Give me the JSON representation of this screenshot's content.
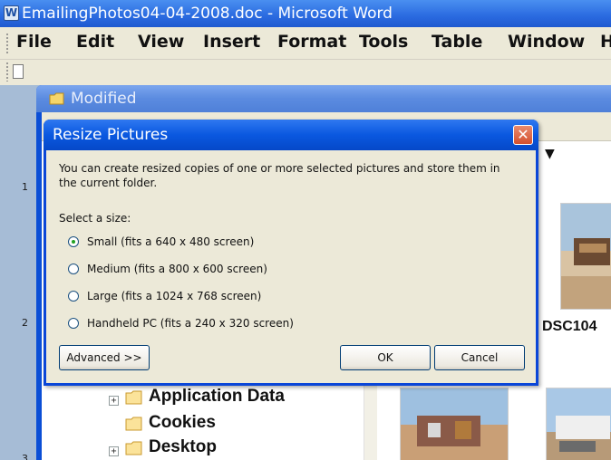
{
  "word": {
    "title": "EmailingPhotos04-04-2008.doc - Microsoft Word",
    "menu": [
      "File",
      "Edit",
      "View",
      "Insert",
      "Format",
      "Tools",
      "Table",
      "Window",
      "H"
    ],
    "ruler_numbers": [
      "1",
      "2",
      "3"
    ]
  },
  "explorer": {
    "title": "Modified",
    "tree": [
      {
        "label": "Application Data",
        "expandable": true
      },
      {
        "label": "Cookies",
        "expandable": false
      },
      {
        "label": "Desktop",
        "expandable": true
      }
    ],
    "thumbnail_label": "DSC104"
  },
  "dialog": {
    "title": "Resize Pictures",
    "description": "You can create resized copies of one or more selected pictures and store them in the current folder.",
    "size_label": "Select a size:",
    "options": [
      {
        "label": "Small (fits a 640 x 480 screen)",
        "checked": true
      },
      {
        "label": "Medium (fits a 800 x 600 screen)",
        "checked": false
      },
      {
        "label": "Large (fits a 1024 x 768 screen)",
        "checked": false
      },
      {
        "label": "Handheld PC (fits a 240 x 320 screen)",
        "checked": false
      }
    ],
    "advanced_label": "Advanced >>",
    "ok_label": "OK",
    "cancel_label": "Cancel"
  }
}
